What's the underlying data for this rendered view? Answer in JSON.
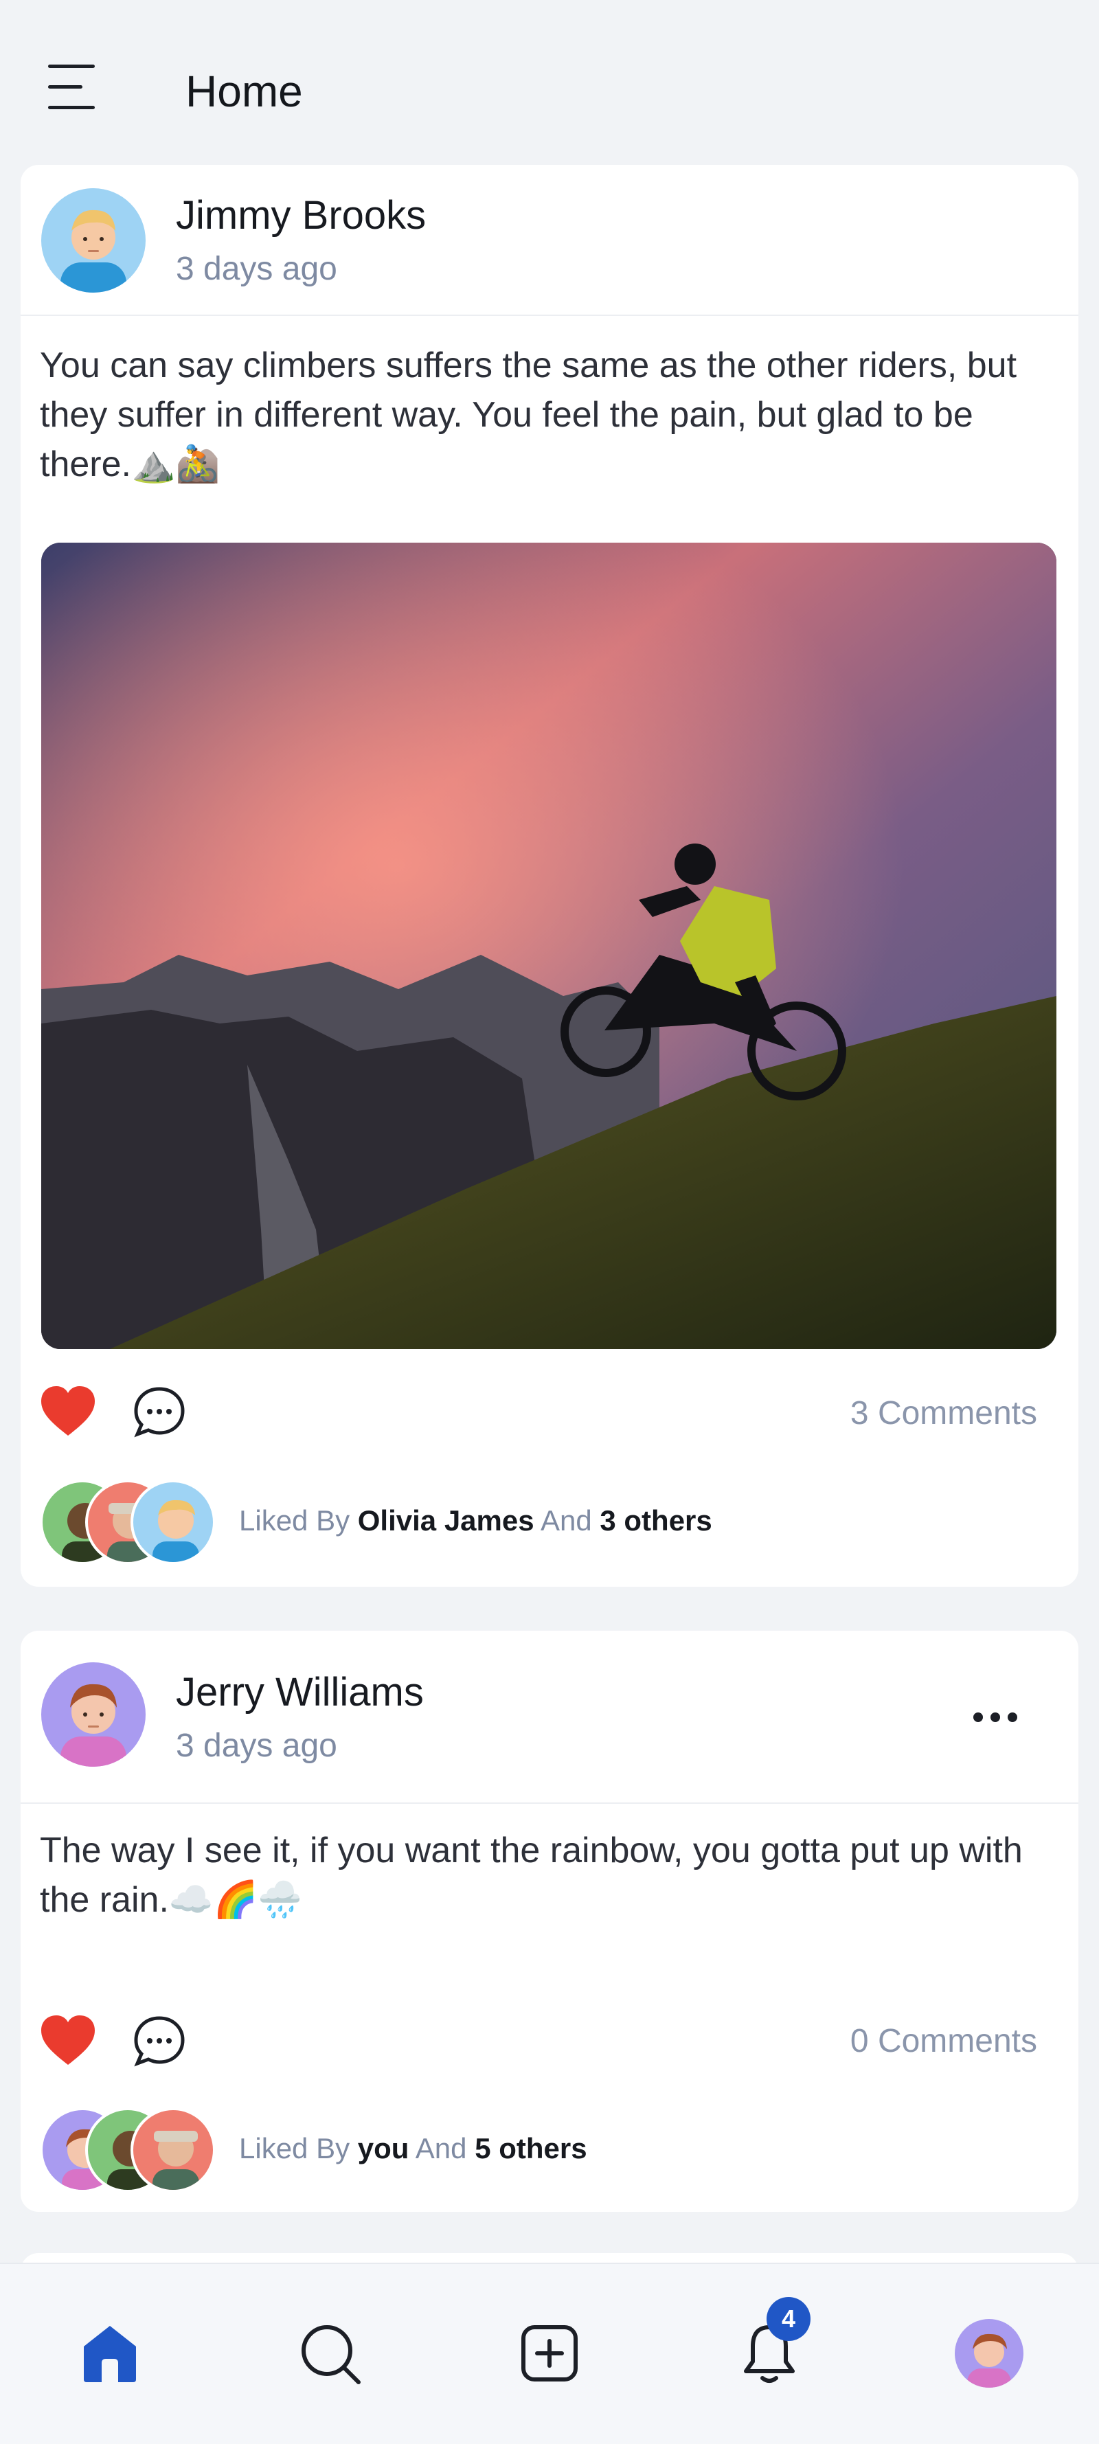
{
  "header": {
    "title": "Home"
  },
  "posts": [
    {
      "author": "Jimmy Brooks",
      "time": "3 days ago",
      "text": "You can say climbers suffers the same as the other riders, but they suffer in different way. You feel the pain, but glad to be there.⛰️🚵",
      "comments_label": "3 Comments",
      "liked_prefix": "Liked By",
      "liked_name": "Olivia James",
      "liked_and": "And",
      "liked_others": "3 others",
      "image_icon": "mountain-bike-photo"
    },
    {
      "author": "Jerry Williams",
      "time": "3 days ago",
      "text": "The way I see it, if you want the rainbow, you gotta put up with the rain.☁️🌈🌧️",
      "comments_label": "0 Comments",
      "liked_prefix": "Liked By",
      "liked_name": "you",
      "liked_and": "And",
      "liked_others": "5 others"
    }
  ],
  "nav": {
    "badge_count": "4",
    "items": [
      "home-icon",
      "search-icon",
      "add-post-icon",
      "notification-icon",
      "profile-avatar"
    ]
  },
  "colors": {
    "accent": "#2057c6",
    "heart": "#ea3b2e",
    "muted_text": "#7e8aa2",
    "background": "#f1f3f6"
  }
}
